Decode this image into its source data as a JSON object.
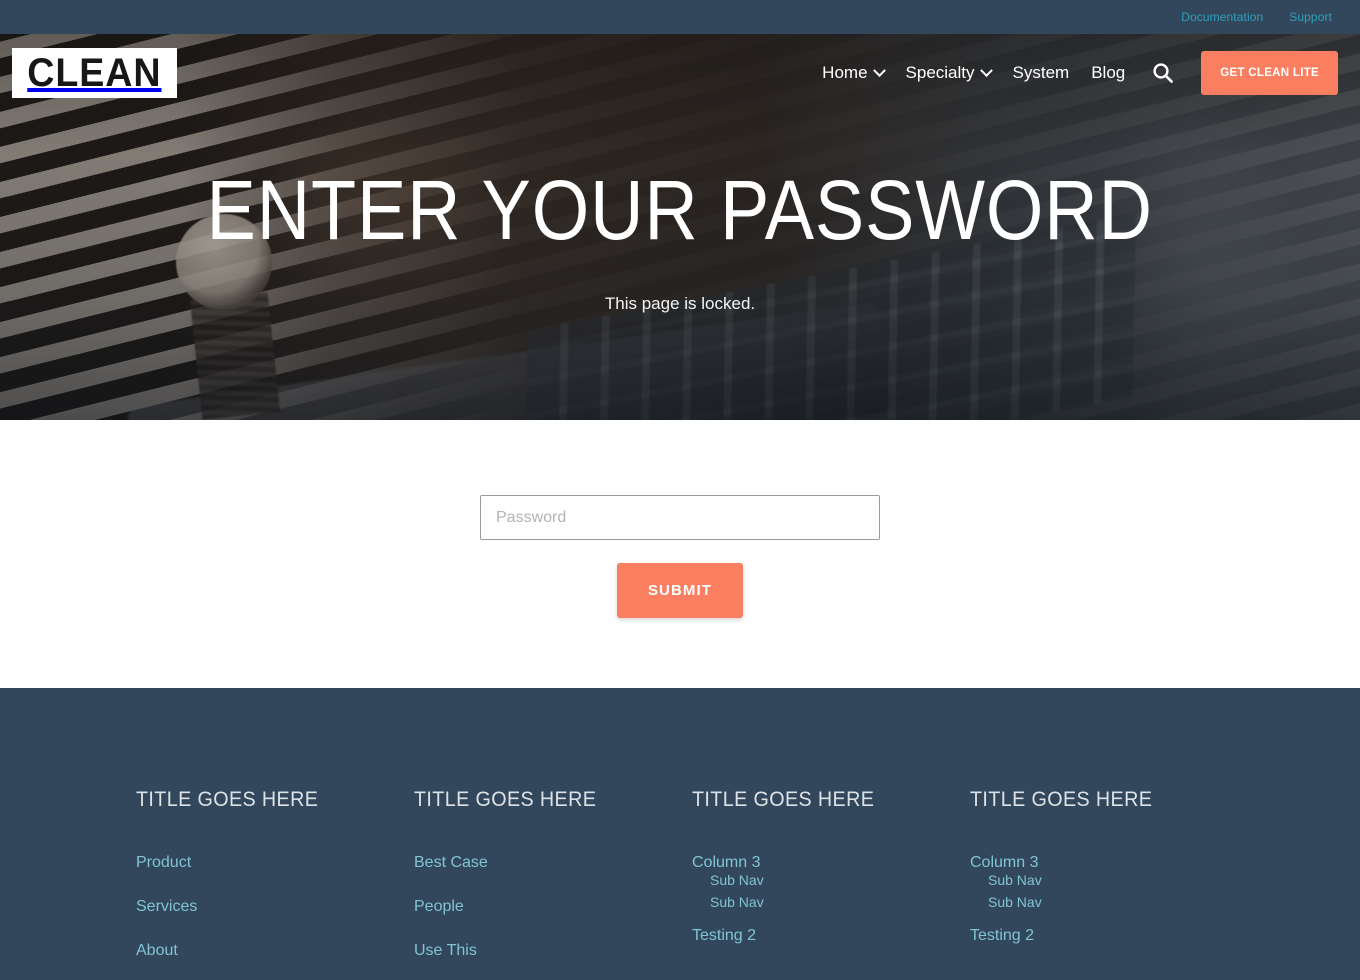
{
  "topbar": {
    "links": [
      {
        "label": "Documentation"
      },
      {
        "label": "Support"
      }
    ]
  },
  "header": {
    "logo": "CLEAN",
    "nav": [
      {
        "label": "Home",
        "has_dropdown": true
      },
      {
        "label": "Specialty",
        "has_dropdown": true
      },
      {
        "label": "System",
        "has_dropdown": false
      },
      {
        "label": "Blog",
        "has_dropdown": false
      }
    ],
    "search_icon": "search-icon",
    "cta_label": "GET CLEAN LITE"
  },
  "hero": {
    "title": "ENTER YOUR PASSWORD",
    "subtitle": "This page is locked."
  },
  "form": {
    "password_placeholder": "Password",
    "password_value": "",
    "submit_label": "SUBMIT"
  },
  "footer": {
    "columns": [
      {
        "title": "TITLE GOES HERE",
        "links": [
          {
            "label": "Product",
            "sub": []
          },
          {
            "label": "Services",
            "sub": []
          },
          {
            "label": "About",
            "sub": []
          }
        ]
      },
      {
        "title": "TITLE GOES HERE",
        "links": [
          {
            "label": "Best Case",
            "sub": []
          },
          {
            "label": "People",
            "sub": []
          },
          {
            "label": "Use This",
            "sub": []
          }
        ]
      },
      {
        "title": "TITLE GOES HERE",
        "links": [
          {
            "label": "Column 3",
            "sub": [
              {
                "label": "Sub Nav"
              },
              {
                "label": "Sub Nav"
              }
            ]
          },
          {
            "label": "Testing 2",
            "sub": []
          }
        ]
      },
      {
        "title": "TITLE GOES HERE",
        "links": [
          {
            "label": "Column 3",
            "sub": [
              {
                "label": "Sub Nav"
              },
              {
                "label": "Sub Nav"
              }
            ]
          },
          {
            "label": "Testing 2",
            "sub": []
          }
        ]
      }
    ]
  },
  "colors": {
    "dark_slate": "#32475c",
    "accent_orange": "#fa7f60",
    "footer_link_teal": "#81c4d4",
    "topbar_link_teal": "#2e9fbd",
    "footer_title": "#dde2e6"
  }
}
